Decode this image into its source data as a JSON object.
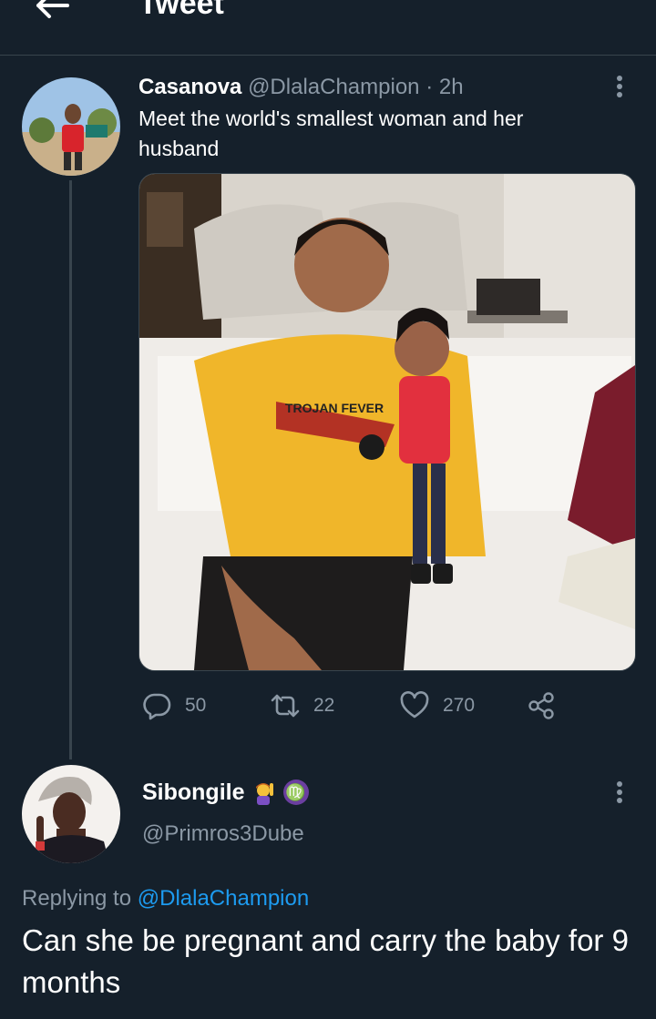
{
  "header": {
    "title": "Tweet",
    "back_icon": "arrow-left-icon"
  },
  "tweet": {
    "author_name": "Casanova",
    "author_handle": "@DlalaChampion",
    "separator": "·",
    "time": "2h",
    "text": "Meet the world's smallest woman and her husband",
    "media_alt": "photo",
    "shirt_text": "TROJAN FEVER",
    "stats": {
      "replies": "50",
      "retweets": "22",
      "likes": "270"
    }
  },
  "reply": {
    "author_name": "Sibongile",
    "emoji_1": "woman-raising-hand-emoji",
    "emoji_2": "♍",
    "author_handle": "@Primros3Dube",
    "replying_prefix": "Replying to",
    "replying_handle": "@DlalaChampion",
    "text": "Can she be pregnant and carry the baby for 9 months"
  },
  "colors": {
    "background": "#15202b",
    "muted": "#8b98a5",
    "link": "#1d9bf0",
    "divider": "#38444d"
  }
}
